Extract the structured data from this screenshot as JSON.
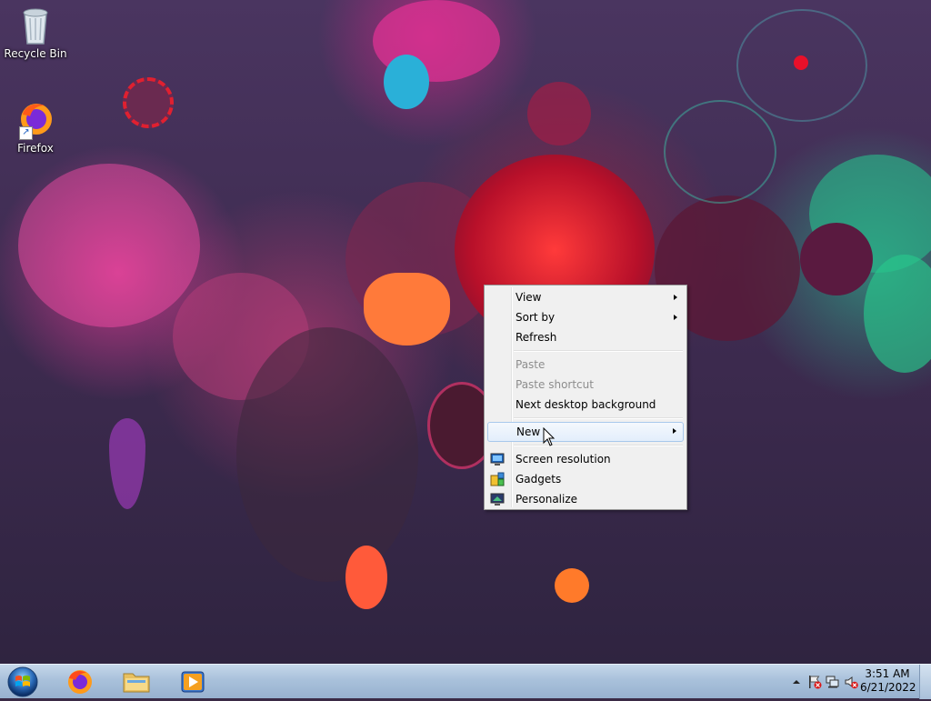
{
  "desktop": {
    "icons": [
      {
        "label": "Recycle Bin",
        "icon": "recycle-bin-icon"
      },
      {
        "label": "Firefox",
        "icon": "firefox-icon"
      }
    ]
  },
  "context_menu": {
    "items": [
      {
        "label": "View",
        "submenu": true,
        "enabled": true
      },
      {
        "label": "Sort by",
        "submenu": true,
        "enabled": true
      },
      {
        "label": "Refresh",
        "submenu": false,
        "enabled": true
      },
      {
        "label": "Paste",
        "submenu": false,
        "enabled": false
      },
      {
        "label": "Paste shortcut",
        "submenu": false,
        "enabled": false
      },
      {
        "label": "Next desktop background",
        "submenu": false,
        "enabled": true
      },
      {
        "label": "New",
        "submenu": true,
        "enabled": true,
        "highlighted": true
      },
      {
        "label": "Screen resolution",
        "submenu": false,
        "enabled": true,
        "icon": "screen-resolution-icon"
      },
      {
        "label": "Gadgets",
        "submenu": false,
        "enabled": true,
        "icon": "gadgets-icon"
      },
      {
        "label": "Personalize",
        "submenu": false,
        "enabled": true,
        "icon": "personalize-icon"
      }
    ]
  },
  "taskbar": {
    "pinned": [
      {
        "name": "Firefox",
        "icon": "firefox-icon"
      },
      {
        "name": "Windows Explorer",
        "icon": "folder-icon"
      },
      {
        "name": "Windows Media Player",
        "icon": "media-player-icon"
      }
    ],
    "tray_icons": [
      "show-hidden-icons-arrow",
      "action-center-flag-icon",
      "network-icon",
      "volume-muted-icon"
    ],
    "clock": {
      "time": "3:51 AM",
      "date": "6/21/2022"
    }
  },
  "colors": {
    "menu_bg": "#f0f0f0",
    "menu_highlight_border": "#a8c8ec",
    "disabled_text": "#8d8d8d",
    "taskbar": "#a9c1db"
  }
}
